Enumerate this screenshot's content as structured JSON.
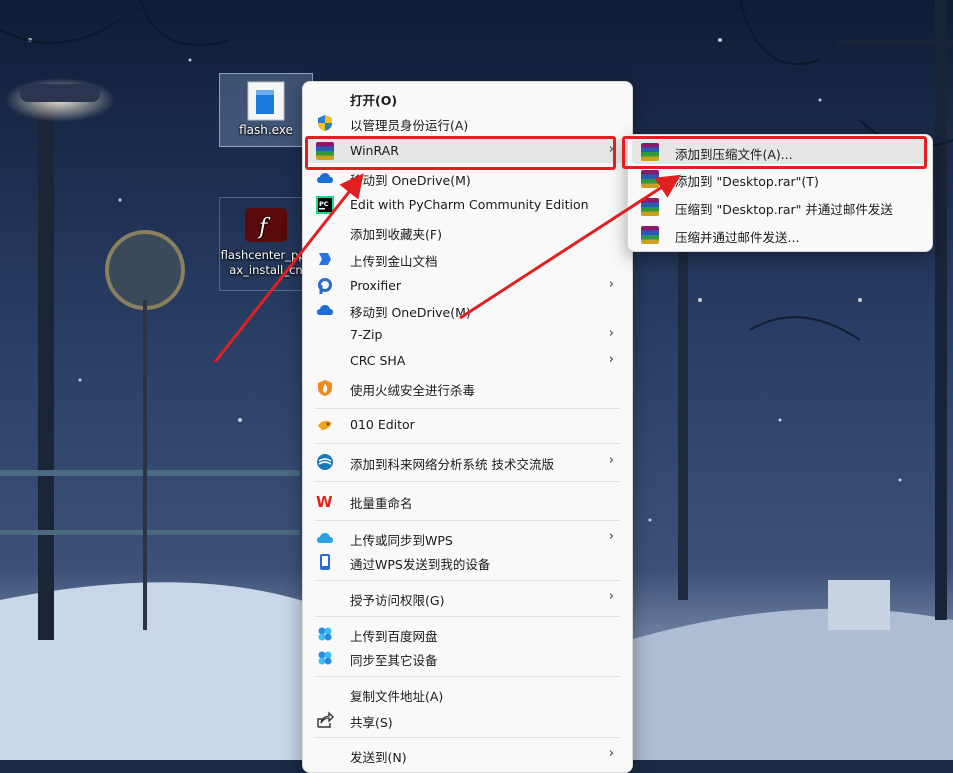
{
  "desktop": {
    "icons": [
      {
        "label": "flash.exe"
      },
      {
        "label": "flashcenter_pp_ax_install_cn"
      }
    ]
  },
  "context_menu": {
    "items": [
      {
        "label": "打开(O)"
      },
      {
        "label": "以管理员身份运行(A)"
      },
      {
        "label": "WinRAR"
      },
      {
        "label": "移动到 OneDrive(M)"
      },
      {
        "label": "Edit with PyCharm Community Edition"
      },
      {
        "label": "添加到收藏夹(F)"
      },
      {
        "label": "上传到金山文档"
      },
      {
        "label": "Proxifier"
      },
      {
        "label": "移动到 OneDrive(M)"
      },
      {
        "label": "7-Zip"
      },
      {
        "label": "CRC SHA"
      },
      {
        "label": "使用火绒安全进行杀毒"
      },
      {
        "label": "010 Editor"
      },
      {
        "label": "添加到科来网络分析系统 技术交流版"
      },
      {
        "label": "批量重命名"
      },
      {
        "label": "上传或同步到WPS"
      },
      {
        "label": "通过WPS发送到我的设备"
      },
      {
        "label": "授予访问权限(G)"
      },
      {
        "label": "上传到百度网盘"
      },
      {
        "label": "同步至其它设备"
      },
      {
        "label": "复制文件地址(A)"
      },
      {
        "label": "共享(S)"
      },
      {
        "label": "发送到(N)"
      }
    ],
    "submenu_arrow": "›"
  },
  "winrar_submenu": {
    "items": [
      {
        "label": "添加到压缩文件(A)..."
      },
      {
        "label": "添加到 \"Desktop.rar\"(T)"
      },
      {
        "label": "压缩到 \"Desktop.rar\" 并通过邮件发送"
      },
      {
        "label": "压缩并通过邮件发送..."
      }
    ]
  },
  "colors": {
    "callout": "#e02020",
    "menu_bg": "#f9f9f9",
    "highlight": "#e6e6e6"
  },
  "icons": {
    "open": "none",
    "run-as-admin": "uac-shield-icon",
    "winrar": "winrar-icon",
    "onedrive": "onedrive-cloud-icon",
    "pycharm": "pycharm-icon",
    "kdocs": "kdocs-icon",
    "proxifier": "proxifier-icon",
    "huorong": "huorong-icon",
    "010editor": "010-editor-icon",
    "colasoft": "colasoft-icon",
    "wps": "wps-icon",
    "baidu": "baidu-netdisk-icon",
    "share": "share-icon"
  }
}
